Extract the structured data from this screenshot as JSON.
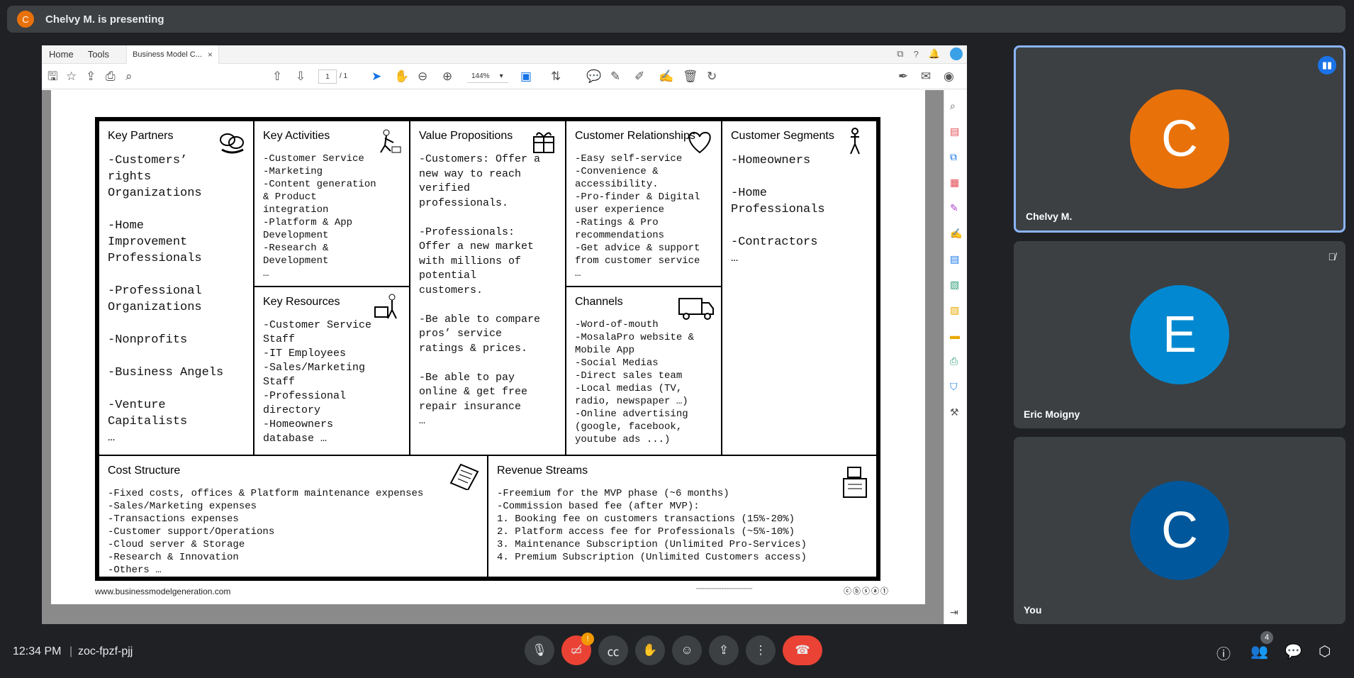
{
  "presenter_bar": {
    "avatar_letter": "C",
    "text": "Chelvy M. is presenting"
  },
  "pdf": {
    "menu": [
      "Home",
      "Tools"
    ],
    "tab_title": "Business Model C...",
    "tab_close": "×",
    "page_current": "1",
    "page_total": "/ 1",
    "zoom": "144%",
    "zoom_caret": "▾"
  },
  "canvas": {
    "key_partners": {
      "title": "Key Partners",
      "body": "-Customers’\nrights\nOrganizations\n\n-Home\nImprovement\nProfessionals\n\n-Professional\nOrganizations\n\n-Nonprofits\n\n-Business Angels\n\n-Venture\nCapitalists\n…"
    },
    "key_activities": {
      "title": "Key Activities",
      "body": "-Customer Service\n-Marketing\n-Content generation\n& Product\nintegration\n-Platform & App\nDevelopment\n-Research &\nDevelopment\n…"
    },
    "key_resources": {
      "title": "Key Resources",
      "body": "-Customer Service\nStaff\n-IT Employees\n-Sales/Marketing\nStaff\n-Professional\ndirectory\n-Homeowners\ndatabase …"
    },
    "value_propositions": {
      "title": "Value Propositions",
      "body": "-Customers: Offer a\nnew way to reach\nverified\nprofessionals.\n\n-Professionals:\nOffer a new market\nwith millions of\npotential\ncustomers.\n\n-Be able to compare\npros’ service\nratings & prices.\n\n-Be able to pay\nonline & get free\nrepair insurance\n…"
    },
    "customer_relationships": {
      "title": "Customer Relationships",
      "body": "-Easy self-service\n-Convenience &\naccessibility.\n-Pro-finder & Digital\nuser experience\n-Ratings & Pro\nrecommendations\n-Get advice & support\nfrom customer service\n…"
    },
    "channels": {
      "title": "Channels",
      "body": "-Word-of-mouth\n-MosalaPro website &\nMobile App\n-Social Medias\n-Direct sales team\n-Local medias (TV,\nradio, newspaper …)\n-Online advertising\n(google, facebook,\nyoutube ads ...)"
    },
    "customer_segments": {
      "title": "Customer Segments",
      "body": "-Homeowners\n\n-Home\nProfessionals\n\n-Contractors\n…"
    },
    "cost_structure": {
      "title": "Cost Structure",
      "body": "-Fixed costs, offices & Platform maintenance expenses\n-Sales/Marketing expenses\n-Transactions expenses\n-Customer support/Operations\n-Cloud server & Storage\n-Research & Innovation\n-Others …"
    },
    "revenue_streams": {
      "title": "Revenue Streams",
      "body": "-Freemium for the MVP phase (~6 months)\n-Commission based fee (after MVP):\n 1.    Booking fee on customers transactions (15%-20%)\n 2.    Platform access fee for Professionals (~5%-10%)\n 3.    Maintenance Subscription (Unlimited Pro-Services)\n 4.    Premium Subscription (Unlimited Customers access)"
    },
    "footer_url": "www.businessmodelgeneration.com",
    "cc_badges": "ⓒⓑⓢⓐ①"
  },
  "participants": [
    {
      "name": "Chelvy M.",
      "letter": "C",
      "color": "#e8710a",
      "speaking": true
    },
    {
      "name": "Eric Moigny",
      "letter": "E",
      "color": "#0288d1",
      "muted": true
    },
    {
      "name": "You",
      "letter": "C",
      "color": "#01579b"
    }
  ],
  "bottom": {
    "time": "12:34 PM",
    "separator": "|",
    "meeting_code": "zoc-fpzf-pjj",
    "camera_alert": "!",
    "participant_count": "4"
  }
}
